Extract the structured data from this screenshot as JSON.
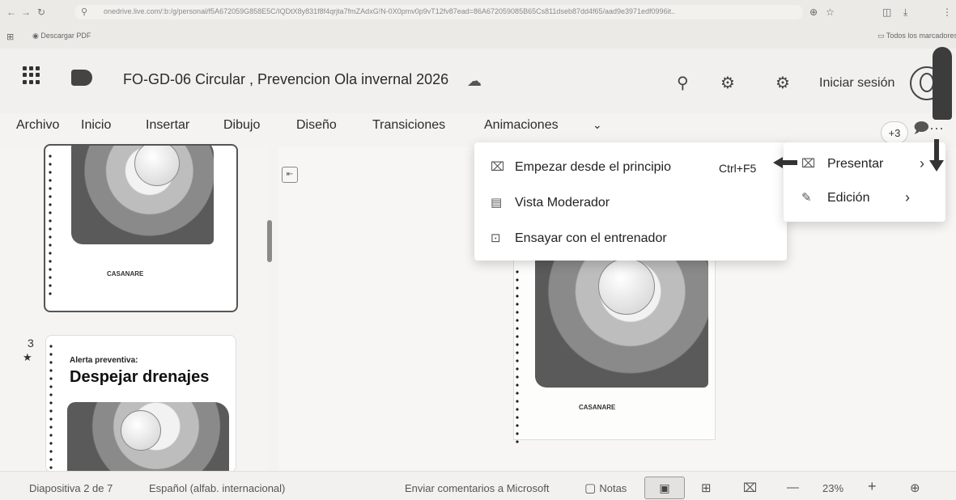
{
  "browser": {
    "url": "onedrive.live.com/:b:/g/personal/f5A672059G858E5C/IQDtX8y831f8f4qrjta7fmZAdxG!N-0X0pmv0p9vT12fv87ead=86A672059085B65Cs811dseb87dd4f65/aad9e3971edf0996it..",
    "bookmark_label": "Descargar PDF",
    "bookmarks_all": "Todos los marcadores"
  },
  "app": {
    "document_title": "FO-GD-06 Circular , Prevencion Ola invernal 2026",
    "signin_label": "Iniciar sesión"
  },
  "ribbon": {
    "tabs": [
      "Archivo",
      "Inicio",
      "Insertar",
      "Dibujo",
      "Diseño",
      "Transiciones",
      "Animaciones"
    ],
    "more_badge": "+3",
    "comments_more": "···"
  },
  "present_menu": {
    "items": [
      {
        "label": "Empezar desde el principio",
        "shortcut": "Ctrl+F5",
        "icon": "present-from-start-icon"
      },
      {
        "label": "Vista Moderador",
        "icon": "presenter-view-icon"
      },
      {
        "label": "Ensayar con el entrenador",
        "icon": "rehearse-coach-icon"
      }
    ]
  },
  "mode_menu": {
    "items": [
      {
        "label": "Presentar",
        "icon": "present-icon"
      },
      {
        "label": "Edición",
        "icon": "pencil-icon"
      }
    ]
  },
  "thumbnails": {
    "seal_label": "CASANARE",
    "slide3_number": "3",
    "slide3_star": "★",
    "slide3_subtitle": "Alerta preventiva:",
    "slide3_title": "Despejar drenajes"
  },
  "status": {
    "slide_counter": "Diapositiva 2 de 7",
    "language": "Español (alfab. internacional)",
    "feedback": "Enviar comentarios a Microsoft",
    "notes_label": "Notas",
    "zoom": "23%"
  }
}
